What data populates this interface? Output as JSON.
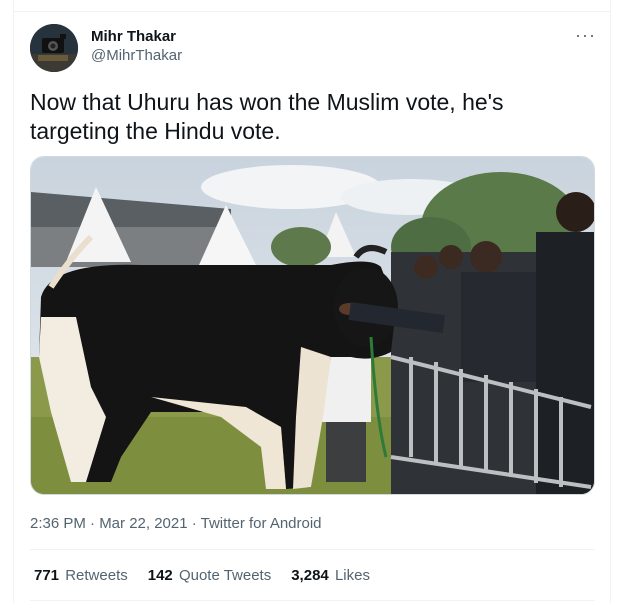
{
  "tweet": {
    "author": {
      "display_name": "Mihr Thakar",
      "handle": "@MihrThakar",
      "avatar_icon": "camera-avatar-icon"
    },
    "more_icon": "more-horizontal-icon",
    "more_label": "···",
    "text": "Now that Uhuru has won the Muslim vote, he's targeting the Hindu vote.",
    "media": {
      "type": "photo",
      "icon": "photo-cow-crowd"
    },
    "timestamp": "2:36 PM · Mar 22, 2021 · ",
    "source": "Twitter for Android",
    "stats": [
      {
        "count": "771",
        "label": "Retweets"
      },
      {
        "count": "142",
        "label": "Quote Tweets"
      },
      {
        "count": "3,284",
        "label": "Likes"
      }
    ]
  },
  "colors": {
    "text_primary": "#0f1419",
    "text_secondary": "#536471",
    "border": "#eff3f4"
  }
}
